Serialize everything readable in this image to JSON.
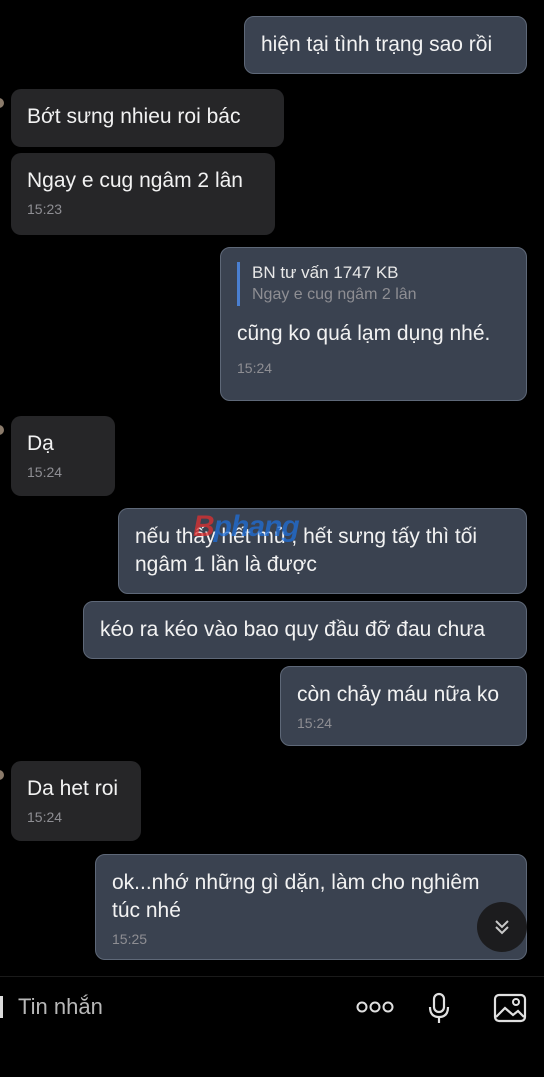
{
  "messages": [
    {
      "text": "hiện tại tình trạng sao rồi"
    },
    {
      "text": "Bớt sưng nhieu roi bác"
    },
    {
      "text": "Ngay e cug ngâm 2 lân",
      "time": "15:23"
    },
    {
      "quote_title": "BN tư vấn 1747 KB",
      "quote_text": "Ngay e cug ngâm 2 lân",
      "text": "cũng ko quá lạm dụng nhé.",
      "time": "15:24"
    },
    {
      "text": "Dạ",
      "time": "15:24"
    },
    {
      "text": "nếu thấy hết mủ , hết sưng tấy thì tối ngâm 1 lần là được"
    },
    {
      "text": "kéo ra kéo vào bao quy đầu đỡ đau chưa"
    },
    {
      "text": "còn chảy máu nữa ko",
      "time": "15:24"
    },
    {
      "text": "Da het roi",
      "time": "15:24"
    },
    {
      "text": "ok...nhớ những gì dặn, làm cho nghiêm túc nhé",
      "time": "15:25"
    }
  ],
  "watermark": {
    "part1": "B",
    "part2": "phang"
  },
  "composer": {
    "placeholder": "Tin nhắn"
  }
}
